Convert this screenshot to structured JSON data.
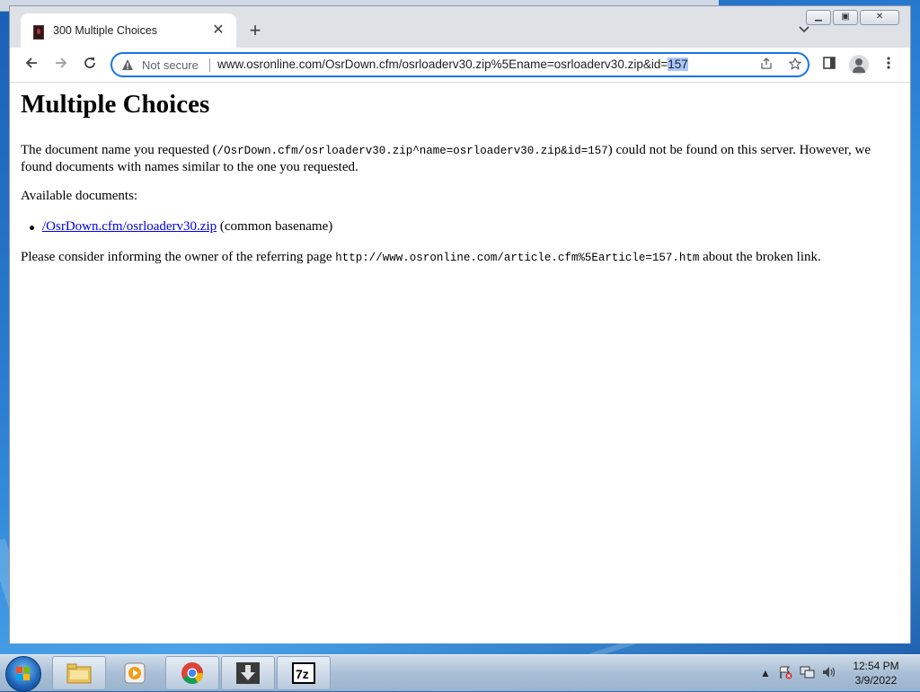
{
  "browser": {
    "tab": {
      "title": "300 Multiple Choices",
      "close_glyph": "✕"
    },
    "new_tab_glyph": "+",
    "address_bar": {
      "security_label": "Not secure",
      "url_main": "www.osronline.com/OsrDown.cfm/osrloaderv30.zip%5Ename=osrloaderv30.zip&id=",
      "url_selected": "157"
    }
  },
  "page": {
    "heading": "Multiple Choices",
    "para1_a": "The document name you requested (",
    "para1_code": "/OsrDown.cfm/osrloaderv30.zip^name=osrloaderv30.zip&id=157",
    "para1_b": ") could not be found on this server. However, we found documents with names similar to the one you requested.",
    "available_label": "Available documents:",
    "documents": [
      {
        "link": "/OsrDown.cfm/osrloaderv30.zip",
        "note": " (common basename)"
      }
    ],
    "para3_a": "Please consider informing the owner of the referring page ",
    "para3_code": "http://www.osronline.com/article.cfm%5Earticle=157.htm",
    "para3_b": " about the broken link."
  },
  "taskbar": {
    "apps": [
      "file-explorer-icon",
      "media-player-icon",
      "chrome-icon",
      "download-icon",
      "7zip-icon"
    ],
    "time": "12:54 PM",
    "date": "3/9/2022"
  },
  "colors": {
    "accent": "#1a73e8",
    "link": "#0000ee",
    "selection": "#a8c7fa"
  }
}
